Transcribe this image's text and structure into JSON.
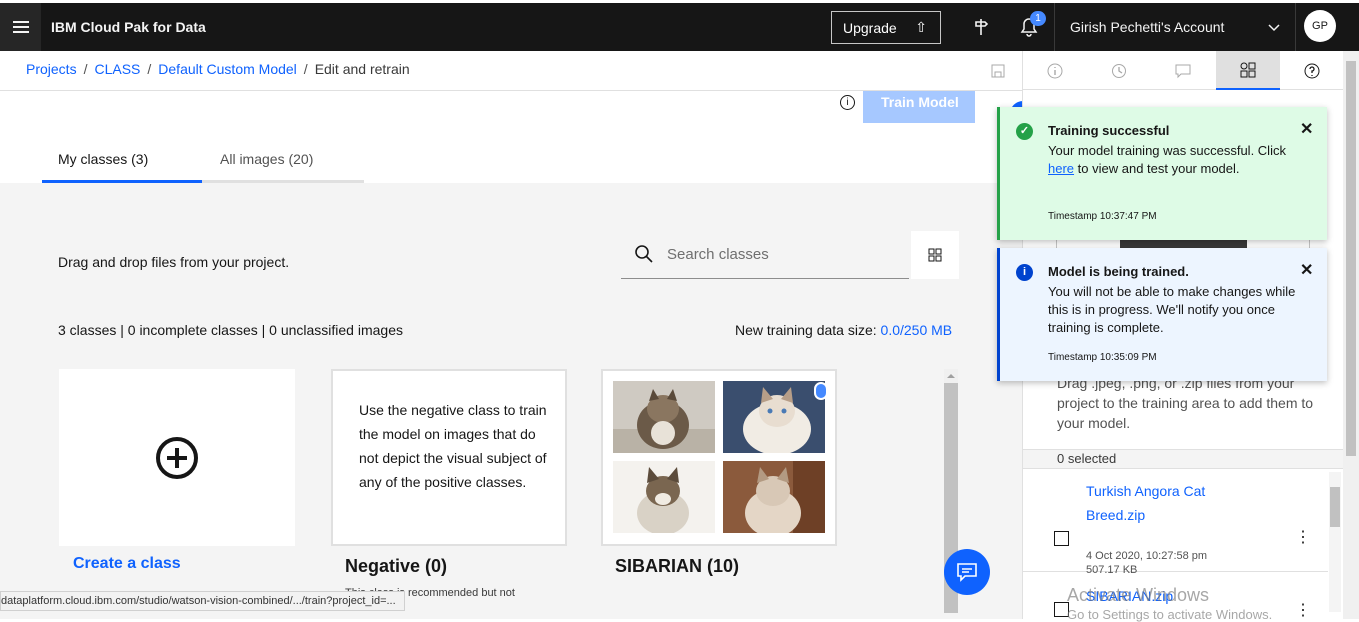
{
  "topbar": {
    "brand": "IBM Cloud Pak for Data",
    "upgrade_label": "Upgrade",
    "notification_count": "1",
    "account_label": "Girish Pechetti's Account",
    "avatar_initials": "GP"
  },
  "breadcrumb": {
    "items": [
      "Projects",
      "CLASS",
      "Default Custom Model"
    ],
    "current": "Edit and retrain",
    "separator": "/"
  },
  "toolbar": {
    "train_label": "Train Model"
  },
  "tabs": {
    "mine": "My classes (3)",
    "all": "All images (20)"
  },
  "main": {
    "drag_text": "Drag and drop files from your project.",
    "search_placeholder": "Search classes",
    "stats": "3 classes | 0 incomplete classes | 0 unclassified images",
    "size_label": "New training data size:",
    "size_value": "0.0/250 MB"
  },
  "cards": {
    "create_label": "Create a class",
    "negative_desc": "Use the negative class to train the model on images that do not depict the visual subject of any of the positive classes.",
    "negative_title": "Negative (0)",
    "negative_note": "This class is recommended but not required.",
    "sibarian_title": "SIBARIAN (10)"
  },
  "toasts": {
    "success": {
      "title": "Training successful",
      "body_pre": "Your model training was successful. Click",
      "link": "here",
      "body_post": "to view and test your model.",
      "timestamp": "Timestamp 10:37:47 PM"
    },
    "info": {
      "title": "Model is being trained.",
      "body": "You will not be able to make changes while this is in progress. We'll notify you once training is complete.",
      "timestamp": "Timestamp 10:35:09 PM"
    }
  },
  "right_panel": {
    "drag_hint": "Drag .jpeg, .png, or .zip files from your project to the training area to add them to your model.",
    "selected": "0 selected",
    "files": [
      {
        "name": "Turkish Angora Cat Breed.zip",
        "date": "4 Oct 2020, 10:27:58 pm",
        "size": "507.17 KB"
      },
      {
        "name": "SIBARIAN.zip"
      }
    ]
  },
  "status_url": "dataplatform.cloud.ibm.com/studio/watson-vision-combined/.../train?project_id=...",
  "watermark": {
    "line1": "Activate Windows",
    "line2": "Go to Settings to activate Windows."
  },
  "colors": {
    "accent": "#0f62fe",
    "success": "#24a148",
    "info": "#0043ce",
    "topbar": "#161616"
  }
}
